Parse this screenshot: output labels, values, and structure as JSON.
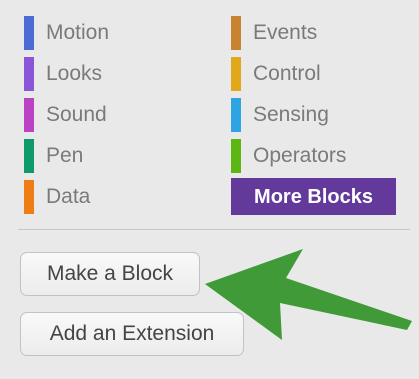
{
  "categories": [
    {
      "label": "Motion",
      "color": "#4a6cd4"
    },
    {
      "label": "Looks",
      "color": "#8a55d7"
    },
    {
      "label": "Sound",
      "color": "#bb42c3"
    },
    {
      "label": "Pen",
      "color": "#0e9a6c"
    },
    {
      "label": "Data",
      "color": "#ee7d16"
    },
    {
      "label": "Events",
      "color": "#c88330"
    },
    {
      "label": "Control",
      "color": "#e1a91a"
    },
    {
      "label": "Sensing",
      "color": "#2ca5e2"
    },
    {
      "label": "Operators",
      "color": "#5cb712"
    },
    {
      "label": "More Blocks",
      "color": "#63399c"
    }
  ],
  "selected_category": "More Blocks",
  "buttons": {
    "make_block": "Make a Block",
    "add_extension": "Add an Extension"
  },
  "annotation": {
    "arrow_color": "#3f9a37"
  }
}
